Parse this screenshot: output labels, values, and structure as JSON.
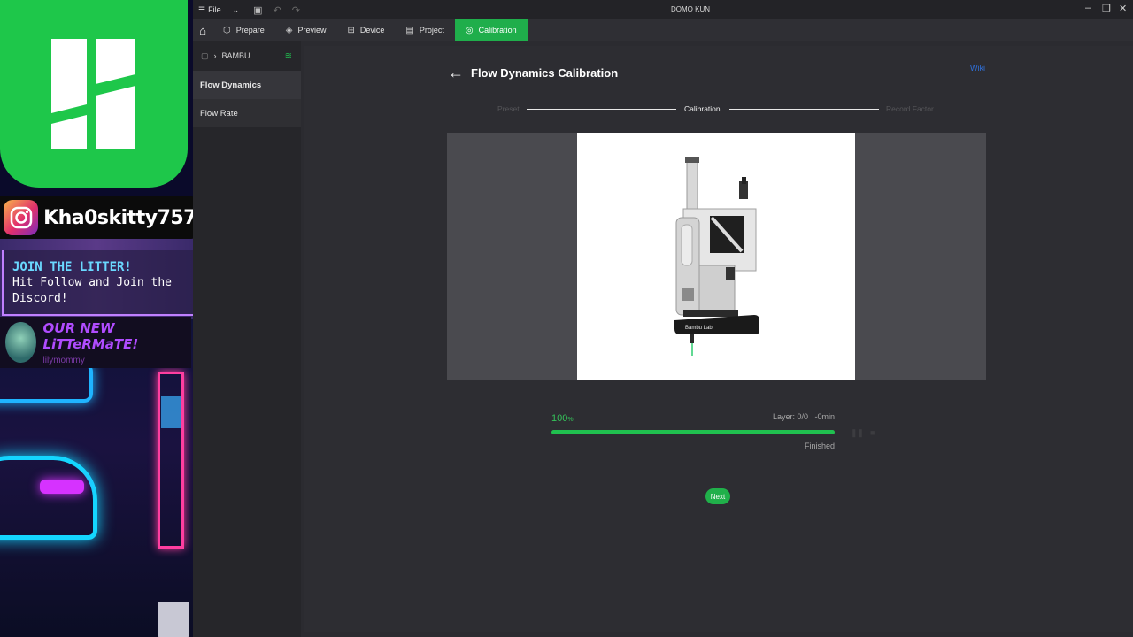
{
  "overlay": {
    "instagram_handle": "Kha0skitty757",
    "join_title": "JOIN THE LITTER!",
    "join_body": "Hit Follow and Join the Discord!",
    "new_mate_label": "OUR NEW LiTTeRMaTE!",
    "new_mate_name": "lilymommy"
  },
  "titlebar": {
    "file_label": "File",
    "window_title": "DOMO KUN"
  },
  "tabs": [
    {
      "label": "Prepare",
      "icon": "cube-icon"
    },
    {
      "label": "Preview",
      "icon": "layers-icon"
    },
    {
      "label": "Device",
      "icon": "device-icon"
    },
    {
      "label": "Project",
      "icon": "project-icon"
    },
    {
      "label": "Calibration",
      "icon": "calibration-icon",
      "active": true
    }
  ],
  "sidebar": {
    "device_name": "BAMBU",
    "items": [
      {
        "label": "Flow Dynamics",
        "active": true
      },
      {
        "label": "Flow Rate",
        "active": false
      }
    ]
  },
  "page": {
    "title": "Flow Dynamics Calibration",
    "wiki_label": "Wiki",
    "steps": [
      "Preset",
      "Calibration",
      "Record Factor"
    ],
    "current_step": "Calibration"
  },
  "progress": {
    "percent": "100",
    "percent_unit": "%",
    "fraction": 1.0,
    "layer_label": "Layer: 0/0",
    "time_label": "-0min",
    "status": "Finished"
  },
  "next_label": "Next",
  "printer_label": "Bambu Lab",
  "colors": {
    "accent": "#20c04f",
    "wiki": "#2f6fd8",
    "logo_green": "#1ec74a"
  }
}
